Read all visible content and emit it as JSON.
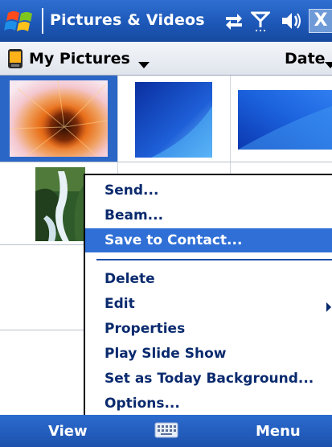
{
  "titlebar": {
    "title": "Pictures & Videos",
    "start_icon": "windows-flag-icon",
    "status_icons": [
      "connectivity-icon",
      "signal-icon",
      "volume-icon"
    ],
    "close_label": "X"
  },
  "folderbar": {
    "folder_label": "My Pictures",
    "sort_label": "Date"
  },
  "menu": {
    "items": [
      {
        "label": "Send..."
      },
      {
        "label": "Beam..."
      },
      {
        "label": "Save to Contact..."
      },
      {
        "label": "Delete"
      },
      {
        "label": "Edit"
      },
      {
        "label": "Properties"
      },
      {
        "label": "Play Slide Show"
      },
      {
        "label": "Set as Today Background..."
      },
      {
        "label": "Options..."
      }
    ],
    "highlighted_index": 2
  },
  "softkeys": {
    "left": "View",
    "right": "Menu"
  },
  "colors": {
    "titlebar": "#1d58b8",
    "highlight": "#2f6fd6",
    "menu_text": "#0a2a6e"
  }
}
